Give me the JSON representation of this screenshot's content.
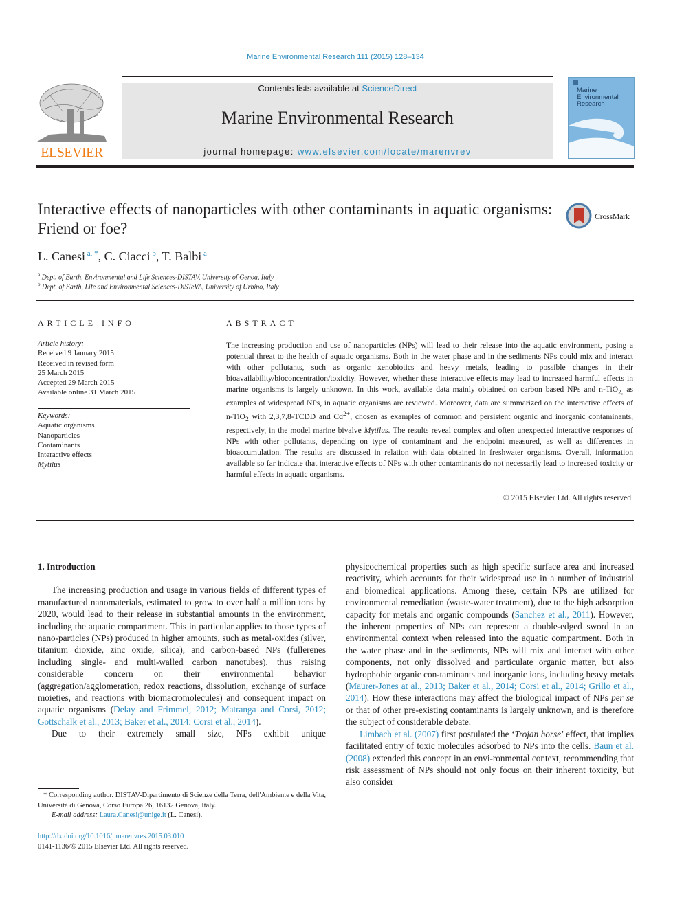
{
  "header": {
    "journal_ref": "Marine Environmental Research 111 (2015) 128–134",
    "contents_prefix": "Contents lists available at ",
    "contents_link": "ScienceDirect",
    "journal_name": "Marine Environmental Research",
    "homepage_prefix": "journal homepage: ",
    "homepage_link": "www.elsevier.com/locate/marenvrev",
    "publisher_logo": "ELSEVIER",
    "cover": {
      "title_line1": "Marine",
      "title_line2": "Environmental",
      "title_line3": "Research"
    }
  },
  "colors": {
    "link": "#2a8cbf",
    "elsevier_orange": "#f07d16",
    "masthead_bg": "#e6e6e6",
    "cover_blue": "#7fb7e0"
  },
  "article": {
    "title": "Interactive effects of nanoparticles with other contaminants in aquatic organisms: Friend or foe?",
    "crossmark_label": "CrossMark",
    "authors": [
      {
        "name": "L. Canesi",
        "sup": "a, *"
      },
      {
        "name": "C. Ciacci",
        "sup": "b"
      },
      {
        "name": "T. Balbi",
        "sup": "a"
      }
    ],
    "affiliations": [
      {
        "key": "a",
        "text": "Dept. of Earth, Environmental and Life Sciences-DISTAV, University of Genoa, Italy"
      },
      {
        "key": "b",
        "text": "Dept. of Earth, Life and Environmental Sciences-DiSTeVA, University of Urbino, Italy"
      }
    ]
  },
  "article_info": {
    "heading": "ARTICLE INFO",
    "history_label": "Article history:",
    "history": [
      "Received 9 January 2015",
      "Received in revised form",
      "25 March 2015",
      "Accepted 29 March 2015",
      "Available online 31 March 2015"
    ],
    "keywords_label": "Keywords:",
    "keywords": [
      "Aquatic organisms",
      "Nanoparticles",
      "Contaminants",
      "Interactive effects",
      "Mytilus"
    ]
  },
  "abstract": {
    "heading": "ABSTRACT",
    "part1": "The increasing production and use of nanoparticles (NPs) will lead to their release into the aquatic environment, posing a potential threat to the health of aquatic organisms. Both in the water phase and in the sediments NPs could mix and interact with other pollutants, such as organic xenobiotics and heavy metals, leading to possible changes in their bioavailability/bioconcentration/toxicity. However, whether these interactive effects may lead to increased harmful effects in marine organisms is largely unknown. In this work, available data mainly obtained on carbon based NPs and n-TiO",
    "sub1": "2,",
    "part2": " as examples of widespread NPs, in aquatic organisms are reviewed. Moreover, data are summarized on the interactive effects of n-TiO",
    "sub2": "2",
    "part3": " with 2,3,7,8-TCDD and Cd",
    "sup1": "2+",
    "part4": ", chosen as examples of common and persistent organic and inorganic contaminants, respectively, in the model marine bivalve ",
    "italic1": "Mytilus",
    "part5": ". The results reveal complex and often unexpected interactive responses of NPs with other pollutants, depending on type of contaminant and the endpoint measured, as well as differences in bioaccumulation. The results are discussed in relation with data obtained in freshwater organisms. Overall, information available so far indicate that interactive effects of NPs with other contaminants do not necessarily lead to increased toxicity or harmful effects in aquatic organisms.",
    "copyright": "© 2015 Elsevier Ltd. All rights reserved."
  },
  "body": {
    "section_heading": "1.  Introduction",
    "left_p1": "The increasing production and usage in various fields of different types of manufactured nanomaterials, estimated to grow to over half a million tons by 2020, would lead to their release in substantial amounts in the environment, including the aquatic compartment. This in particular applies to those types of nano-particles (NPs) produced in higher amounts, such as metal-oxides (silver, titanium dioxide, zinc oxide, silica), and carbon-based NPs (fullerenes including single- and multi-walled carbon nanotubes), thus raising considerable concern on their environmental behavior (aggregation/agglomeration, redox reactions, dissolution, exchange of surface moieties, and reactions with biomacromolecules) and consequent impact on aquatic organisms (",
    "left_p1_cite": "Delay and Frimmel, 2012; Matranga and Corsi, 2012; Gottschalk et al., 2013; Baker et al., 2014; Corsi et al., 2014",
    "left_p1_end": ").",
    "left_p2": "Due to their extremely small size, NPs exhibit unique",
    "right_p1a": "physicochemical properties such as high specific surface area and increased reactivity, which accounts for their widespread use in a number of industrial and biomedical applications. Among these, certain NPs are utilized for environmental remediation (waste-water treatment), due to the high adsorption capacity for metals and organic compounds (",
    "right_p1_cite1": "Sanchez et al., 2011",
    "right_p1b": "). However, the inherent properties of NPs can represent a double-edged sword in an environmental context when released into the aquatic compartment. Both in the water phase and in the sediments, NPs will mix and interact with other components, not only dissolved and particulate organic matter, but also hydrophobic organic con-taminants and inorganic ions, including heavy metals (",
    "right_p1_cite2": "Maurer-Jones at al., 2013; Baker et al., 2014; Corsi et al., 2014; Grillo et al., 2014",
    "right_p1c": "). How these interactions may affect the biological impact of NPs ",
    "right_p1_italic": "per se",
    "right_p1d": " or that of other pre-existing contaminants is largely unknown, and is therefore the subject of considerable debate.",
    "right_p2_cite1": "Limbach et al. (2007)",
    "right_p2a": " first postulated the ‘",
    "right_p2_italic": "Trojan horse",
    "right_p2b": "’ effect, that implies facilitated entry of toxic molecules adsorbed to NPs into the cells. ",
    "right_p2_cite2": "Baun et al. (2008)",
    "right_p2c": " extended this concept in an envi-ronmental context, recommending that risk assessment of NPs should not only focus on their inherent toxicity, but also consider"
  },
  "footnotes": {
    "corresponding": "* Corresponding author. DISTAV-Dipartimento di Scienze della Terra, dell'Ambiente e della Vita, Università di Genova, Corso Europa 26, 16132 Genova, Italy.",
    "email_label": "E-mail address: ",
    "email": "Laura.Canesi@unige.it",
    "email_suffix": " (L. Canesi).",
    "doi": "http://dx.doi.org/10.1016/j.marenvres.2015.03.010",
    "issn": "0141-1136/© 2015 Elsevier Ltd. All rights reserved."
  }
}
